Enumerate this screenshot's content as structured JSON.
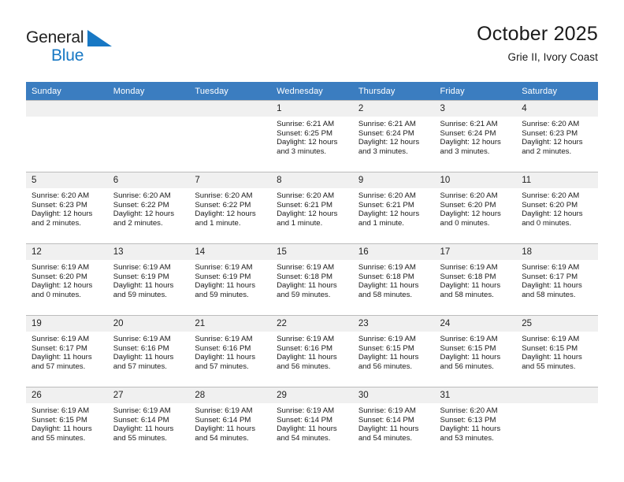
{
  "brand": {
    "name_line1": "General",
    "name_line2": "Blue",
    "accent_color": "#1878c4",
    "triangle_icon": "triangle-icon"
  },
  "header": {
    "title": "October 2025",
    "subtitle": "Grie II, Ivory Coast"
  },
  "calendar": {
    "header_bg": "#3b7dc0",
    "daynum_bg": "#f0f0f0",
    "weekdays": [
      "Sunday",
      "Monday",
      "Tuesday",
      "Wednesday",
      "Thursday",
      "Friday",
      "Saturday"
    ],
    "labels": {
      "sunrise": "Sunrise:",
      "sunset": "Sunset:",
      "daylight": "Daylight:"
    },
    "weeks": [
      [
        {
          "day": "",
          "empty": true
        },
        {
          "day": "",
          "empty": true
        },
        {
          "day": "",
          "empty": true
        },
        {
          "day": "1",
          "sunrise": "Sunrise: 6:21 AM",
          "sunset": "Sunset: 6:25 PM",
          "daylight1": "Daylight: 12 hours",
          "daylight2": "and 3 minutes."
        },
        {
          "day": "2",
          "sunrise": "Sunrise: 6:21 AM",
          "sunset": "Sunset: 6:24 PM",
          "daylight1": "Daylight: 12 hours",
          "daylight2": "and 3 minutes."
        },
        {
          "day": "3",
          "sunrise": "Sunrise: 6:21 AM",
          "sunset": "Sunset: 6:24 PM",
          "daylight1": "Daylight: 12 hours",
          "daylight2": "and 3 minutes."
        },
        {
          "day": "4",
          "sunrise": "Sunrise: 6:20 AM",
          "sunset": "Sunset: 6:23 PM",
          "daylight1": "Daylight: 12 hours",
          "daylight2": "and 2 minutes."
        }
      ],
      [
        {
          "day": "5",
          "sunrise": "Sunrise: 6:20 AM",
          "sunset": "Sunset: 6:23 PM",
          "daylight1": "Daylight: 12 hours",
          "daylight2": "and 2 minutes."
        },
        {
          "day": "6",
          "sunrise": "Sunrise: 6:20 AM",
          "sunset": "Sunset: 6:22 PM",
          "daylight1": "Daylight: 12 hours",
          "daylight2": "and 2 minutes."
        },
        {
          "day": "7",
          "sunrise": "Sunrise: 6:20 AM",
          "sunset": "Sunset: 6:22 PM",
          "daylight1": "Daylight: 12 hours",
          "daylight2": "and 1 minute."
        },
        {
          "day": "8",
          "sunrise": "Sunrise: 6:20 AM",
          "sunset": "Sunset: 6:21 PM",
          "daylight1": "Daylight: 12 hours",
          "daylight2": "and 1 minute."
        },
        {
          "day": "9",
          "sunrise": "Sunrise: 6:20 AM",
          "sunset": "Sunset: 6:21 PM",
          "daylight1": "Daylight: 12 hours",
          "daylight2": "and 1 minute."
        },
        {
          "day": "10",
          "sunrise": "Sunrise: 6:20 AM",
          "sunset": "Sunset: 6:20 PM",
          "daylight1": "Daylight: 12 hours",
          "daylight2": "and 0 minutes."
        },
        {
          "day": "11",
          "sunrise": "Sunrise: 6:20 AM",
          "sunset": "Sunset: 6:20 PM",
          "daylight1": "Daylight: 12 hours",
          "daylight2": "and 0 minutes."
        }
      ],
      [
        {
          "day": "12",
          "sunrise": "Sunrise: 6:19 AM",
          "sunset": "Sunset: 6:20 PM",
          "daylight1": "Daylight: 12 hours",
          "daylight2": "and 0 minutes."
        },
        {
          "day": "13",
          "sunrise": "Sunrise: 6:19 AM",
          "sunset": "Sunset: 6:19 PM",
          "daylight1": "Daylight: 11 hours",
          "daylight2": "and 59 minutes."
        },
        {
          "day": "14",
          "sunrise": "Sunrise: 6:19 AM",
          "sunset": "Sunset: 6:19 PM",
          "daylight1": "Daylight: 11 hours",
          "daylight2": "and 59 minutes."
        },
        {
          "day": "15",
          "sunrise": "Sunrise: 6:19 AM",
          "sunset": "Sunset: 6:18 PM",
          "daylight1": "Daylight: 11 hours",
          "daylight2": "and 59 minutes."
        },
        {
          "day": "16",
          "sunrise": "Sunrise: 6:19 AM",
          "sunset": "Sunset: 6:18 PM",
          "daylight1": "Daylight: 11 hours",
          "daylight2": "and 58 minutes."
        },
        {
          "day": "17",
          "sunrise": "Sunrise: 6:19 AM",
          "sunset": "Sunset: 6:18 PM",
          "daylight1": "Daylight: 11 hours",
          "daylight2": "and 58 minutes."
        },
        {
          "day": "18",
          "sunrise": "Sunrise: 6:19 AM",
          "sunset": "Sunset: 6:17 PM",
          "daylight1": "Daylight: 11 hours",
          "daylight2": "and 58 minutes."
        }
      ],
      [
        {
          "day": "19",
          "sunrise": "Sunrise: 6:19 AM",
          "sunset": "Sunset: 6:17 PM",
          "daylight1": "Daylight: 11 hours",
          "daylight2": "and 57 minutes."
        },
        {
          "day": "20",
          "sunrise": "Sunrise: 6:19 AM",
          "sunset": "Sunset: 6:16 PM",
          "daylight1": "Daylight: 11 hours",
          "daylight2": "and 57 minutes."
        },
        {
          "day": "21",
          "sunrise": "Sunrise: 6:19 AM",
          "sunset": "Sunset: 6:16 PM",
          "daylight1": "Daylight: 11 hours",
          "daylight2": "and 57 minutes."
        },
        {
          "day": "22",
          "sunrise": "Sunrise: 6:19 AM",
          "sunset": "Sunset: 6:16 PM",
          "daylight1": "Daylight: 11 hours",
          "daylight2": "and 56 minutes."
        },
        {
          "day": "23",
          "sunrise": "Sunrise: 6:19 AM",
          "sunset": "Sunset: 6:15 PM",
          "daylight1": "Daylight: 11 hours",
          "daylight2": "and 56 minutes."
        },
        {
          "day": "24",
          "sunrise": "Sunrise: 6:19 AM",
          "sunset": "Sunset: 6:15 PM",
          "daylight1": "Daylight: 11 hours",
          "daylight2": "and 56 minutes."
        },
        {
          "day": "25",
          "sunrise": "Sunrise: 6:19 AM",
          "sunset": "Sunset: 6:15 PM",
          "daylight1": "Daylight: 11 hours",
          "daylight2": "and 55 minutes."
        }
      ],
      [
        {
          "day": "26",
          "sunrise": "Sunrise: 6:19 AM",
          "sunset": "Sunset: 6:15 PM",
          "daylight1": "Daylight: 11 hours",
          "daylight2": "and 55 minutes."
        },
        {
          "day": "27",
          "sunrise": "Sunrise: 6:19 AM",
          "sunset": "Sunset: 6:14 PM",
          "daylight1": "Daylight: 11 hours",
          "daylight2": "and 55 minutes."
        },
        {
          "day": "28",
          "sunrise": "Sunrise: 6:19 AM",
          "sunset": "Sunset: 6:14 PM",
          "daylight1": "Daylight: 11 hours",
          "daylight2": "and 54 minutes."
        },
        {
          "day": "29",
          "sunrise": "Sunrise: 6:19 AM",
          "sunset": "Sunset: 6:14 PM",
          "daylight1": "Daylight: 11 hours",
          "daylight2": "and 54 minutes."
        },
        {
          "day": "30",
          "sunrise": "Sunrise: 6:19 AM",
          "sunset": "Sunset: 6:14 PM",
          "daylight1": "Daylight: 11 hours",
          "daylight2": "and 54 minutes."
        },
        {
          "day": "31",
          "sunrise": "Sunrise: 6:20 AM",
          "sunset": "Sunset: 6:13 PM",
          "daylight1": "Daylight: 11 hours",
          "daylight2": "and 53 minutes."
        },
        {
          "day": "",
          "empty": true
        }
      ]
    ]
  }
}
